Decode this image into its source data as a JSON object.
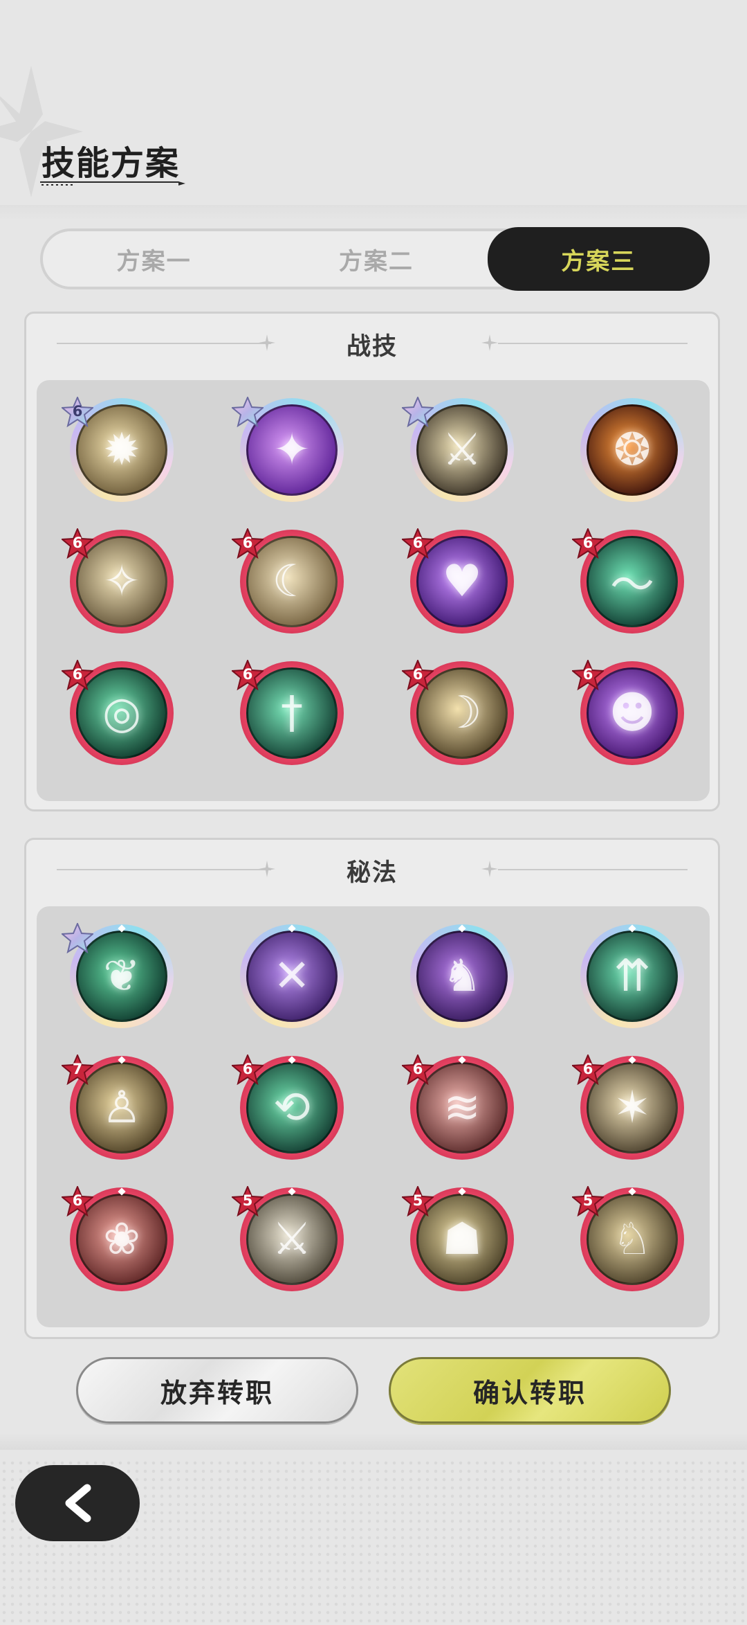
{
  "header": {
    "title": "技能方案"
  },
  "tabs": [
    {
      "label": "方案一",
      "active": false
    },
    {
      "label": "方案二",
      "active": false
    },
    {
      "label": "方案三",
      "active": true
    }
  ],
  "colors": {
    "active_tab_bg": "#1f1f1f",
    "active_tab_text": "#d7d65a",
    "confirm_button": "#d6d65c",
    "rank_badge": "#c8253b",
    "prismatic_badge": "#b8b4e8"
  },
  "sections": {
    "combat": {
      "title": "战技",
      "skills": [
        {
          "icon": "golden-burst-icon",
          "badge": "6",
          "badge_type": "prismatic",
          "rarity": "prismatic"
        },
        {
          "icon": "purple-chain-star-icon",
          "badge": "",
          "badge_type": "prismatic",
          "rarity": "prismatic"
        },
        {
          "icon": "shadow-sword-strike-icon",
          "badge": "",
          "badge_type": "prismatic",
          "rarity": "prismatic"
        },
        {
          "icon": "fire-swirl-icon",
          "badge": "",
          "badge_type": "none",
          "rarity": "prismatic"
        },
        {
          "icon": "golden-blade-icon",
          "badge": "6",
          "badge_type": "red",
          "rarity": "red"
        },
        {
          "icon": "golden-slash-icon",
          "badge": "6",
          "badge_type": "red",
          "rarity": "red"
        },
        {
          "icon": "purple-heart-icon",
          "badge": "6",
          "badge_type": "red",
          "rarity": "red"
        },
        {
          "icon": "green-wave-icon",
          "badge": "6",
          "badge_type": "red",
          "rarity": "red"
        },
        {
          "icon": "green-vortex-icon",
          "badge": "6",
          "badge_type": "red",
          "rarity": "red"
        },
        {
          "icon": "green-greatsword-icon",
          "badge": "6",
          "badge_type": "red",
          "rarity": "red"
        },
        {
          "icon": "golden-crescent-icon",
          "badge": "6",
          "badge_type": "red",
          "rarity": "red"
        },
        {
          "icon": "purple-ghost-icon",
          "badge": "6",
          "badge_type": "red",
          "rarity": "red"
        }
      ]
    },
    "arcane": {
      "title": "秘法",
      "skills": [
        {
          "icon": "green-leaf-icon",
          "badge": "",
          "badge_type": "prismatic",
          "rarity": "prismatic"
        },
        {
          "icon": "purple-sword-orb-icon",
          "badge": "",
          "badge_type": "none",
          "rarity": "prismatic"
        },
        {
          "icon": "purple-demon-icon",
          "badge": "",
          "badge_type": "none",
          "rarity": "prismatic"
        },
        {
          "icon": "green-crystal-arrows-icon",
          "badge": "",
          "badge_type": "none",
          "rarity": "prismatic"
        },
        {
          "icon": "golden-figure-shield-icon",
          "badge": "7",
          "badge_type": "red",
          "rarity": "red"
        },
        {
          "icon": "green-cycle-arrows-icon",
          "badge": "6",
          "badge_type": "red",
          "rarity": "red"
        },
        {
          "icon": "pink-wind-slash-icon",
          "badge": "6",
          "badge_type": "red",
          "rarity": "red"
        },
        {
          "icon": "golden-impact-icon",
          "badge": "6",
          "badge_type": "red",
          "rarity": "red"
        },
        {
          "icon": "red-flower-burst-icon",
          "badge": "6",
          "badge_type": "red",
          "rarity": "red"
        },
        {
          "icon": "figure-dual-swords-icon",
          "badge": "5",
          "badge_type": "red",
          "rarity": "red"
        },
        {
          "icon": "golden-crowd-icon",
          "badge": "5",
          "badge_type": "red",
          "rarity": "red"
        },
        {
          "icon": "golden-beast-icon",
          "badge": "5",
          "badge_type": "red",
          "rarity": "red"
        }
      ]
    }
  },
  "buttons": {
    "cancel_label": "放弃转职",
    "confirm_label": "确认转职"
  },
  "nav": {
    "back_icon": "chevron-left-icon"
  }
}
